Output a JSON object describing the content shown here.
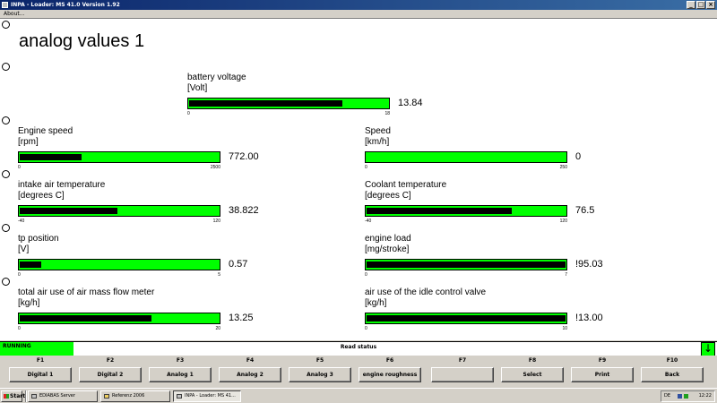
{
  "window": {
    "title": "INPA - Loader:  MS 41.0 Version 1.92",
    "menu_about": "About...",
    "minimize": "_",
    "maximize": "□",
    "close": "×"
  },
  "page_title": "analog values 1",
  "gauges": [
    {
      "label": "battery voltage",
      "unit": "[Volt]",
      "value": "13.84",
      "min": "0",
      "max": "18",
      "fill": 0.77
    },
    {
      "label": "Engine speed",
      "unit": "[rpm]",
      "value": "772.00",
      "min": "0",
      "max": "2500",
      "fill": 0.31
    },
    {
      "label": "Speed",
      "unit": "[km/h]",
      "value": "0",
      "min": "0",
      "max": "250",
      "fill": 0.0
    },
    {
      "label": "intake air temperature",
      "unit": "[degrees C]",
      "value": "38.822",
      "min": "-40",
      "max": "120",
      "fill": 0.49
    },
    {
      "label": "Coolant temperature",
      "unit": "[degrees C]",
      "value": "76.5",
      "min": "-40",
      "max": "120",
      "fill": 0.73
    },
    {
      "label": "tp position",
      "unit": "[V]",
      "value": "0.57",
      "min": "0",
      "max": "5",
      "fill": 0.11
    },
    {
      "label": "engine load",
      "unit": "[mg/stroke]",
      "value": "!95.03",
      "min": "0",
      "max": "7",
      "fill": 1.0
    },
    {
      "label": "total air use of air mass flow meter",
      "unit": "[kg/h]",
      "value": "13.25",
      "min": "0",
      "max": "20",
      "fill": 0.66
    },
    {
      "label": "air use of the idle control valve",
      "unit": "[kg/h]",
      "value": "!13.00",
      "min": "0",
      "max": "10",
      "fill": 1.0
    }
  ],
  "status": {
    "left": "RUNNING",
    "center": "Read status",
    "arrow": "↓"
  },
  "fkeys": [
    {
      "key": "F1",
      "label": "Digital 1"
    },
    {
      "key": "F2",
      "label": "Digital 2"
    },
    {
      "key": "F3",
      "label": "Analog 1"
    },
    {
      "key": "F4",
      "label": "Analog 2"
    },
    {
      "key": "F5",
      "label": "Analog 3"
    },
    {
      "key": "F6",
      "label": "engine roughness"
    },
    {
      "key": "F7",
      "label": ""
    },
    {
      "key": "F8",
      "label": "Select"
    },
    {
      "key": "F9",
      "label": "Print"
    },
    {
      "key": "F10",
      "label": "Back"
    }
  ],
  "taskbar": {
    "start": "Start",
    "items": [
      {
        "label": "EDIABAS Server",
        "active": false
      },
      {
        "label": "Referenz 2006",
        "active": false
      },
      {
        "label": "INPA - Loader:  MS 41...",
        "active": true
      }
    ],
    "tray_lang": "DE",
    "clock": "12:22"
  },
  "colors": {
    "gauge_bar": "#00ff00",
    "gauge_fill": "#000000",
    "status_running": "#00ff00",
    "titlebar": "#0a246a"
  }
}
